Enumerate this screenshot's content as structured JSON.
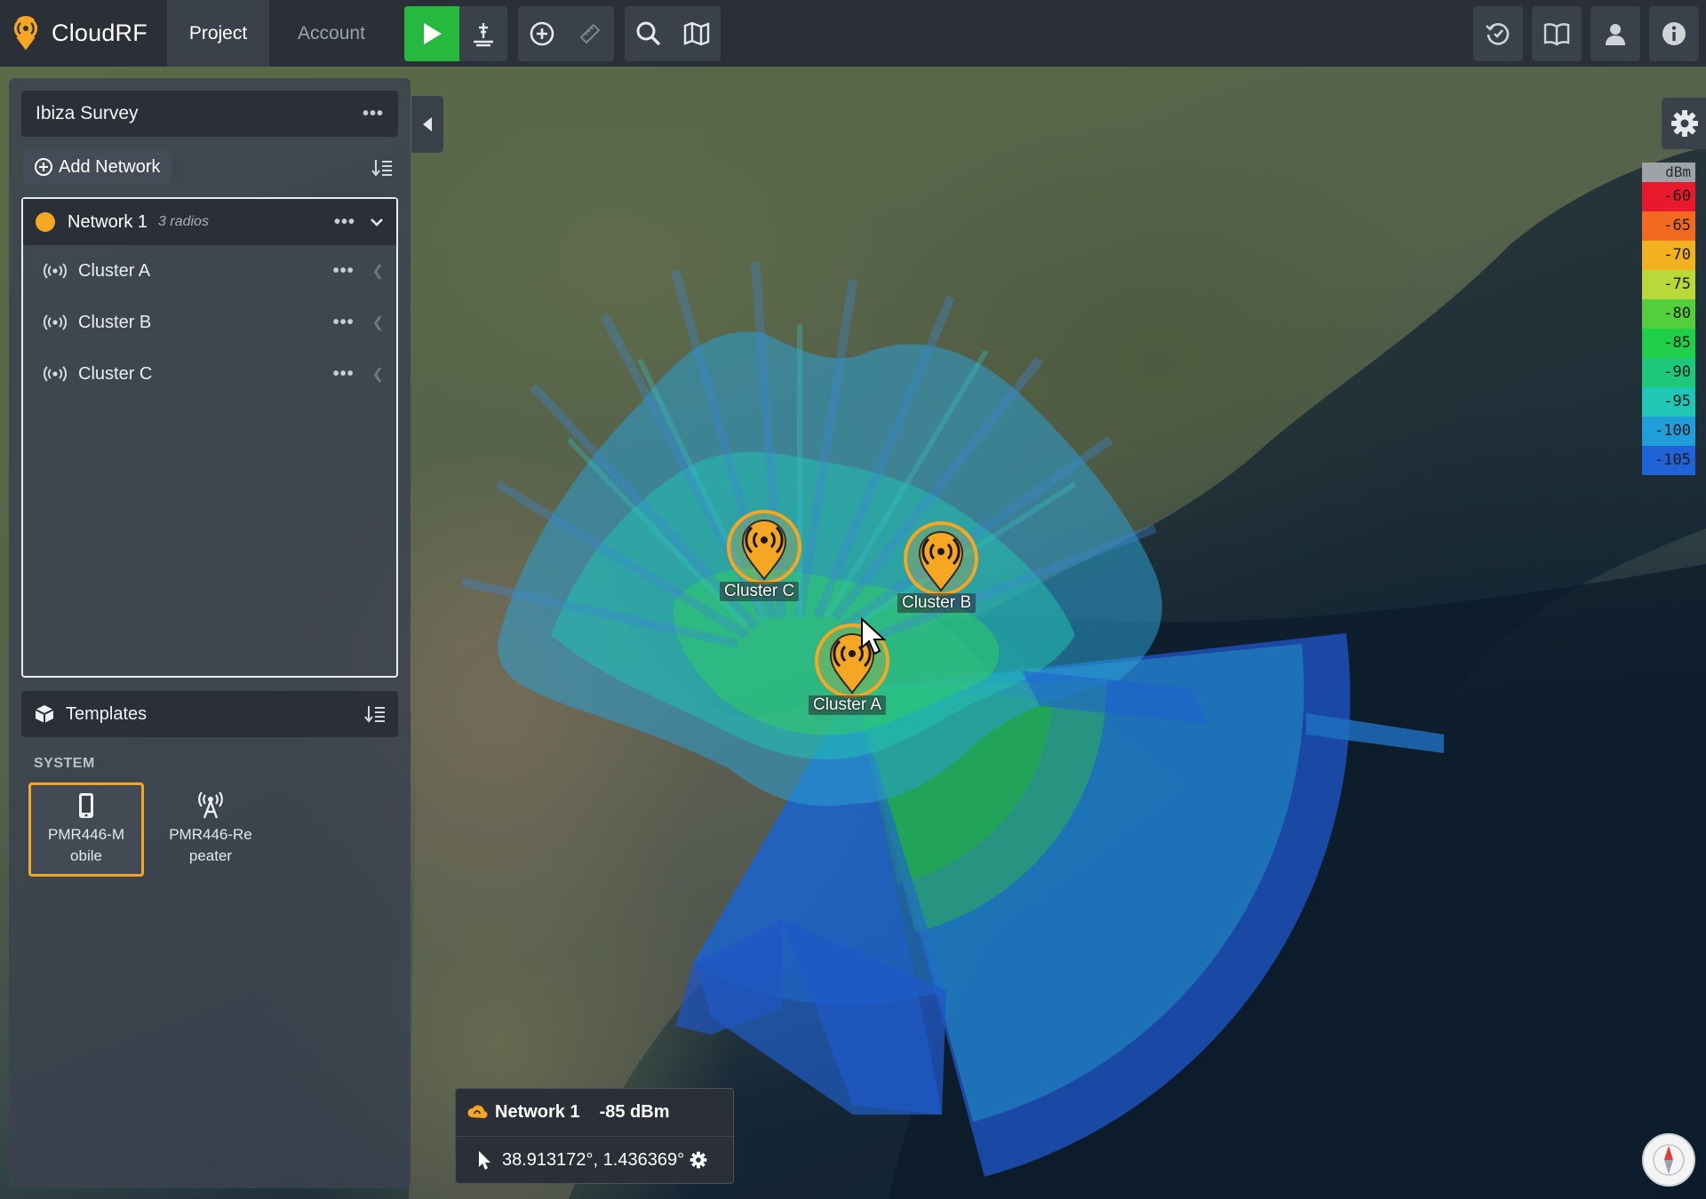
{
  "app": {
    "name": "CloudRF"
  },
  "nav": {
    "tabs": [
      {
        "label": "Project"
      },
      {
        "label": "Account"
      }
    ]
  },
  "toolbar": {
    "icons": [
      "play-icon",
      "ground-antenna-icon",
      "add-icon",
      "ruler-icon",
      "search-icon",
      "map-icon"
    ],
    "right_icons": [
      "history-icon",
      "book-icon",
      "user-icon",
      "info-icon"
    ]
  },
  "project": {
    "title": "Ibiza Survey",
    "add_network_label": "Add Network",
    "network": {
      "name": "Network 1",
      "radio_count": "3 radios",
      "color": "#f5a623",
      "radios": [
        {
          "name": "Cluster A"
        },
        {
          "name": "Cluster B"
        },
        {
          "name": "Cluster C"
        }
      ]
    },
    "templates": {
      "title": "Templates",
      "section": "SYSTEM",
      "items": [
        {
          "label": "PMR446-Mobile",
          "icon": "mobile-icon",
          "selected": true
        },
        {
          "label": "PMR446-Repeater",
          "icon": "antenna-icon",
          "selected": false
        }
      ]
    }
  },
  "map": {
    "markers": [
      {
        "label": "Cluster C"
      },
      {
        "label": "Cluster B"
      },
      {
        "label": "Cluster A"
      }
    ],
    "legend": {
      "unit": "dBm",
      "entries": [
        {
          "value": "-60",
          "color": "#e8192c"
        },
        {
          "value": "-65",
          "color": "#f26a1f"
        },
        {
          "value": "-70",
          "color": "#f2b21f"
        },
        {
          "value": "-75",
          "color": "#b9d83a"
        },
        {
          "value": "-80",
          "color": "#54cf3c"
        },
        {
          "value": "-85",
          "color": "#1fcf47"
        },
        {
          "value": "-90",
          "color": "#1fc77a"
        },
        {
          "value": "-95",
          "color": "#1fc7b4"
        },
        {
          "value": "-100",
          "color": "#1f9ed9"
        },
        {
          "value": "-105",
          "color": "#1f63d6"
        }
      ]
    },
    "readout": {
      "network": "Network 1",
      "signal": "-85 dBm",
      "coords": "38.913172°, 1.436369°"
    }
  }
}
